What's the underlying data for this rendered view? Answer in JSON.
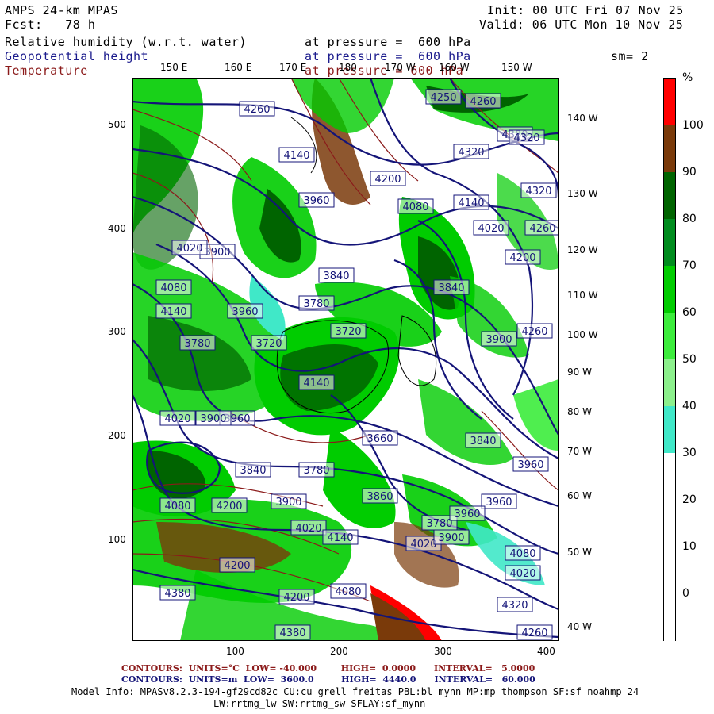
{
  "header": {
    "model": "AMPS 24-km MPAS",
    "fcst_label": "Fcst:",
    "fcst_value": "78 h",
    "init": "Init: 00 UTC Fri 07 Nov 25",
    "valid": "Valid: 06 UTC Mon 10 Nov 25",
    "fields": [
      {
        "name": "Relative humidity (w.r.t. water)",
        "pressure": "at pressure =  600 hPa",
        "color": "#000000"
      },
      {
        "name": "Geopotential height",
        "pressure": "at pressure =  600 hPa",
        "color": "#1a1a8c"
      },
      {
        "name": "Temperature",
        "pressure": "at pressure = 600 hPa",
        "color": "#8b1a1a"
      }
    ],
    "smoothing": "sm= 2"
  },
  "axes": {
    "x_ticks": [
      "100",
      "200",
      "300",
      "400"
    ],
    "y_ticks": [
      "500",
      "400",
      "300",
      "200",
      "100"
    ],
    "top_lon_labels": [
      "150 E",
      "160 E",
      "170 E",
      "180",
      "170 W",
      "160 W",
      "150 W"
    ],
    "right_lon_labels": [
      "140 W",
      "130 W",
      "120 W",
      "110 W",
      "100 W",
      "90 W",
      "80 W",
      "70 W",
      "60 W",
      "50 W",
      "40 W"
    ]
  },
  "colorbar": {
    "unit": "%",
    "labels": [
      "100",
      "90",
      "80",
      "70",
      "60",
      "50",
      "40",
      "30",
      "20",
      "10",
      "0"
    ],
    "colors": [
      "#ff0000",
      "#7a3a0a",
      "#006400",
      "#008c1e",
      "#00cc00",
      "#3cec3c",
      "#8cf08c",
      "#40e8c8",
      "#ffffff",
      "#ffffff",
      "#ffffff",
      "#ffffff"
    ]
  },
  "height_labels": [
    "4260",
    "4380",
    "4320",
    "4140",
    "4200",
    "4320",
    "4080",
    "3960",
    "4140",
    "4020",
    "4260",
    "3900",
    "4200",
    "4080",
    "4020",
    "3840",
    "3780",
    "3960",
    "4140",
    "3780",
    "3720",
    "3900",
    "4020",
    "3660",
    "3840",
    "3720",
    "4140",
    "3960",
    "3900",
    "4260",
    "3840",
    "3780",
    "3840",
    "3960",
    "3960",
    "4080",
    "4200",
    "3900",
    "4020",
    "4140",
    "3780",
    "3860",
    "4020",
    "3960",
    "3900",
    "4020",
    "4080",
    "4320",
    "4200",
    "4380",
    "4260",
    "4380",
    "4080",
    "4200",
    "4260",
    "4320",
    "4250"
  ],
  "footer": {
    "line1": {
      "label": "CONTOURS:",
      "units": "UNITS=°C",
      "low": "LOW= -40.000",
      "high": "HIGH=  0.0000",
      "interval": "INTERVAL=   5.0000"
    },
    "line2": {
      "label": "CONTOURS:",
      "units": "UNITS=m",
      "low": "LOW=  3600.0",
      "high": "HIGH=  4440.0",
      "interval": "INTERVAL=   60.000"
    },
    "model_info_1": "Model Info: MPASv8.2.3-194-gf29cd82c CU:cu_grell_freitas PBL:bl_mynn MP:mp_thompson SF:sf_noahmp 24",
    "model_info_2": "LW:rrtmg_lw SW:rrtmg_sw SFLAY:sf_mynn"
  }
}
